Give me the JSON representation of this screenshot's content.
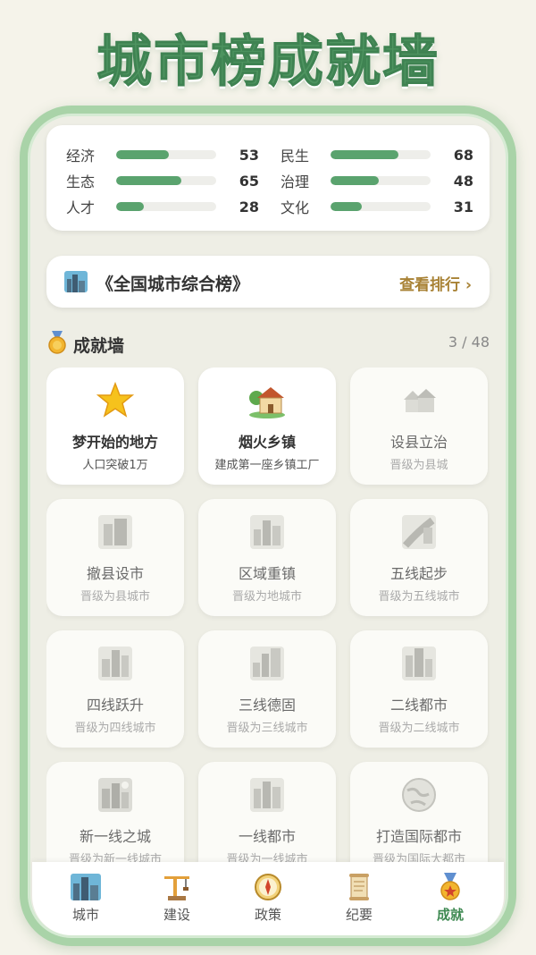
{
  "title": "城市榜成就墙",
  "stats": [
    {
      "label": "经济",
      "value": "53",
      "level": 0.53
    },
    {
      "label": "民生",
      "value": "68",
      "level": 0.68
    },
    {
      "label": "生态",
      "value": "65",
      "level": 0.65
    },
    {
      "label": "治理",
      "value": "48",
      "level": 0.48
    },
    {
      "label": "人才",
      "value": "28",
      "level": 0.28
    },
    {
      "label": "文化",
      "value": "31",
      "level": 0.31
    }
  ],
  "ranking": {
    "icon": "city-skyline-icon",
    "title": "《全国城市综合榜》",
    "link": "查看排行 ›"
  },
  "achievements": {
    "icon": "medal-icon",
    "title": "成就墙",
    "count": "3 / 48",
    "items": [
      {
        "name": "梦开始的地方",
        "desc": "人口突破1万",
        "unlocked": true,
        "icon": "star-icon"
      },
      {
        "name": "烟火乡镇",
        "desc": "建成第一座乡镇工厂",
        "unlocked": true,
        "icon": "house-icon"
      },
      {
        "name": "设县立治",
        "desc": "晋级为县城",
        "unlocked": false,
        "icon": "houses-icon"
      },
      {
        "name": "撤县设市",
        "desc": "晋级为县城市",
        "unlocked": false,
        "icon": "buildings-icon"
      },
      {
        "name": "区域重镇",
        "desc": "晋级为地城市",
        "unlocked": false,
        "icon": "city-icon"
      },
      {
        "name": "五线起步",
        "desc": "晋级为五线城市",
        "unlocked": false,
        "icon": "road-icon"
      },
      {
        "name": "四线跃升",
        "desc": "晋级为四线城市",
        "unlocked": false,
        "icon": "city-icon"
      },
      {
        "name": "三线德固",
        "desc": "晋级为三线城市",
        "unlocked": false,
        "icon": "city-icon"
      },
      {
        "name": "二线都市",
        "desc": "晋级为二线城市",
        "unlocked": false,
        "icon": "city-icon"
      },
      {
        "name": "新一线之城",
        "desc": "晋级为新一线城市",
        "unlocked": false,
        "icon": "night-city-icon"
      },
      {
        "name": "一线都市",
        "desc": "晋级为一线城市",
        "unlocked": false,
        "icon": "city-icon"
      },
      {
        "name": "打造国际都市",
        "desc": "晋级为国际大都市",
        "unlocked": false,
        "icon": "globe-icon"
      }
    ]
  },
  "tabs": [
    {
      "label": "城市",
      "icon": "city-tab-icon",
      "active": false
    },
    {
      "label": "建设",
      "icon": "crane-icon",
      "active": false
    },
    {
      "label": "政策",
      "icon": "compass-icon",
      "active": false
    },
    {
      "label": "纪要",
      "icon": "scroll-icon",
      "active": false
    },
    {
      "label": "成就",
      "icon": "medal-tab-icon",
      "active": true
    }
  ],
  "colors": {
    "accent": "#4e9460",
    "bar": "#5aa36e",
    "link": "#a88235",
    "frame": "#a9d3a8"
  }
}
